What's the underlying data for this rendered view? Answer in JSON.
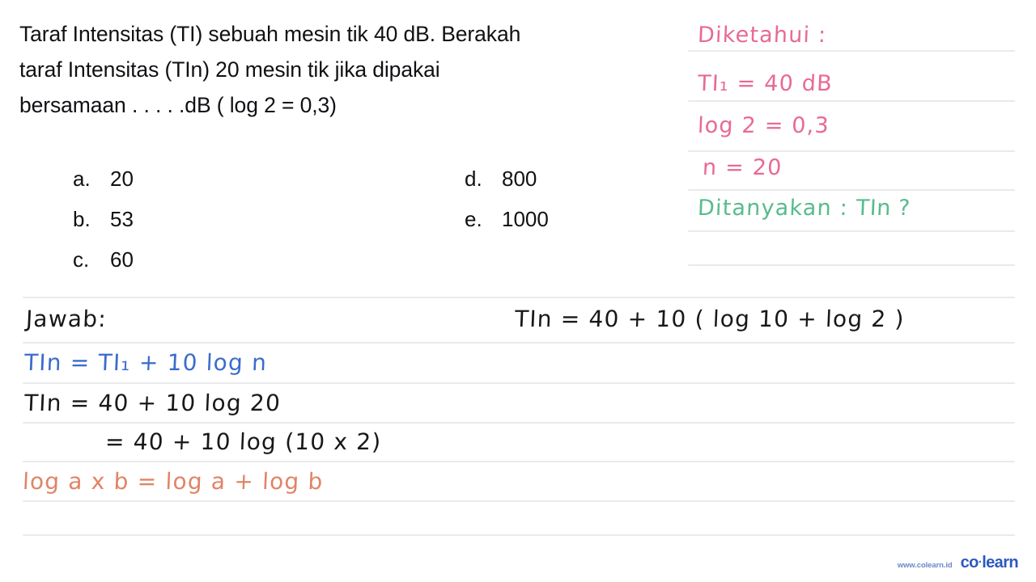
{
  "question": {
    "lines": [
      "Taraf Intensitas (TI) sebuah mesin tik 40 dB. Berakah",
      "taraf Intensitas (TIn) 20 mesin tik jika dipakai",
      "bersamaan . . . . .dB ( log 2 = 0,3)"
    ]
  },
  "options": [
    {
      "key": "a.",
      "value": "20",
      "column": "left",
      "row": 0
    },
    {
      "key": "b.",
      "value": "53",
      "column": "left",
      "row": 1
    },
    {
      "key": "c.",
      "value": "60",
      "column": "left",
      "row": 2
    },
    {
      "key": "d.",
      "value": "800",
      "column": "right",
      "row": 0
    },
    {
      "key": "e.",
      "value": "1000",
      "column": "right",
      "row": 1
    }
  ],
  "known": {
    "heading": "Diketahui :",
    "heading_color": "#e86a92",
    "items": [
      "TI₁ = 40 dB",
      "log 2 = 0,3",
      "n = 20"
    ],
    "asked_label": "Ditanyakan :",
    "asked_value": "TIn ?",
    "asked_color": "#58bb8e"
  },
  "answer": {
    "heading": "Jawab:",
    "formula": "TIn = TI₁ + 10 log n",
    "formula_color": "#3b6ccc",
    "step1": "TIn = 40 + 10 log 20",
    "step2": "= 40 + 10 log (10 x 2)",
    "rule": "log a x b = log a + log b",
    "rule_color": "#e08466",
    "right_step": "TIn = 40 + 10 ( log 10 + log 2 )"
  },
  "watermark": {
    "url": "www.colearn.id",
    "logo_co": "co",
    "logo_dot": "·",
    "logo_learn": "learn",
    "color": "#2c58c0"
  }
}
